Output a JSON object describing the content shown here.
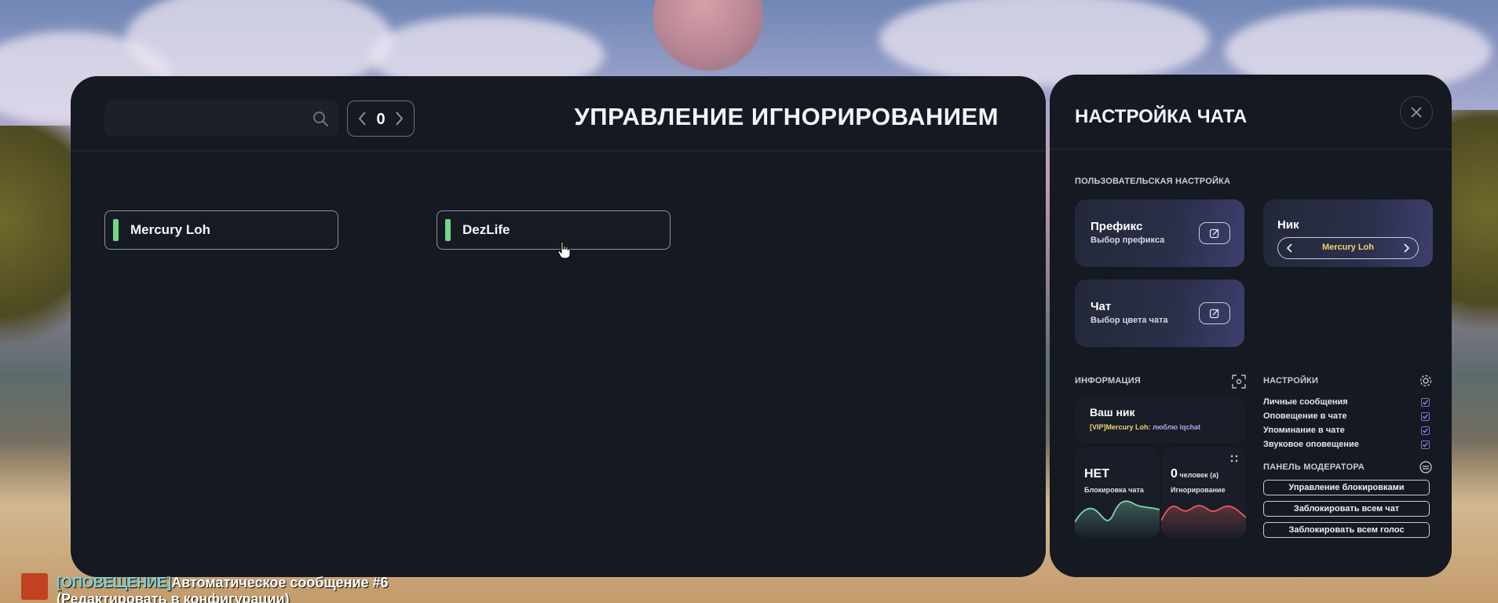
{
  "main": {
    "search": {
      "placeholder": "",
      "value": ""
    },
    "pager": {
      "page": "0"
    },
    "title": "УПРАВЛЕНИЕ ИГНОРИРОВАНИЕМ",
    "users": [
      {
        "name": "Mercury Loh",
        "status_color": "#6fd88a"
      },
      {
        "name": "DezLife",
        "status_color": "#6fd88a"
      }
    ]
  },
  "side": {
    "title": "НАСТРОЙКА ЧАТА",
    "custom_section": "ПОЛЬЗОВАТЕЛЬСКАЯ НАСТРОЙКА",
    "prefix": {
      "title": "Префикс",
      "subtitle": "Выбор префикса"
    },
    "nick": {
      "title": "Ник",
      "value": "Mercury Loh"
    },
    "chat": {
      "title": "Чат",
      "subtitle": "Выбор цвета чата"
    },
    "info": {
      "label": "ИНФОРМАЦИЯ",
      "your_nick_title": "Ваш ник",
      "your_nick_prefix": "[VIP]Mercury Loh:",
      "your_nick_message": " люблю iqchat",
      "block": {
        "value": "НЕТ",
        "label": "Блокировка чата"
      },
      "ignore": {
        "value": "0",
        "unit": " человек (а)",
        "label": "Игнорирование"
      }
    },
    "settings": {
      "label": "НАСТРОЙКИ",
      "items": [
        {
          "label": "Личные сообщения",
          "checked": true
        },
        {
          "label": "Оповещение в чате",
          "checked": true
        },
        {
          "label": "Упоминание в чате",
          "checked": true
        },
        {
          "label": "Звуковое оповещение",
          "checked": true
        }
      ]
    },
    "moderator": {
      "label": "ПАНЕЛЬ МОДЕРАТОРА",
      "buttons": [
        "Управление блокировками",
        "Заблокировать всем чат",
        "Заблокировать всем голос"
      ]
    }
  },
  "notification": {
    "tag": "[ОПОВЕЩЕНИЕ]",
    "text": "Автоматическое сообщение #6",
    "line2": "(Редактировать в конфигурации)"
  },
  "colors": {
    "panel": "#141922",
    "accent_green": "#6fd88a",
    "nick_yellow": "#f2d36b",
    "message_purple": "#b6a2f0",
    "block_wave": "#7fd6b0",
    "ignore_wave": "#e35a5a"
  }
}
